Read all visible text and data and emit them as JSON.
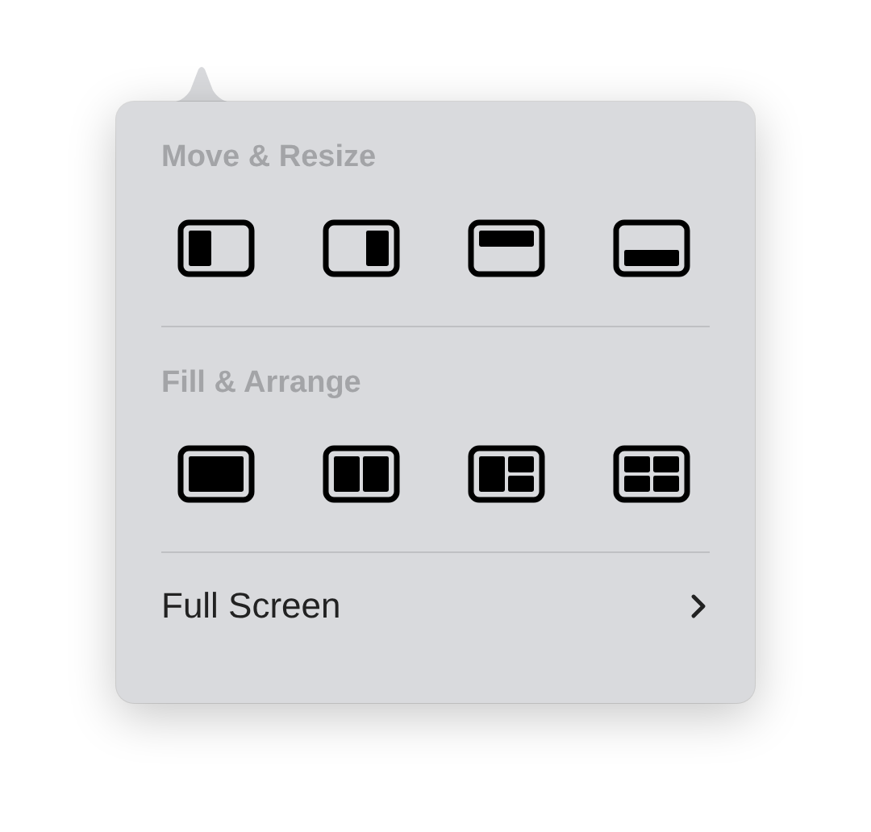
{
  "sections": [
    {
      "heading": "Move & Resize",
      "layouts": [
        {
          "kind": "left-half"
        },
        {
          "kind": "right-half"
        },
        {
          "kind": "top-half"
        },
        {
          "kind": "bottom-half"
        }
      ]
    },
    {
      "heading": "Fill & Arrange",
      "layouts": [
        {
          "kind": "fill"
        },
        {
          "kind": "halves"
        },
        {
          "kind": "left-and-stack"
        },
        {
          "kind": "quarters"
        }
      ]
    }
  ],
  "full_screen": {
    "label": "Full Screen",
    "expandable": true
  }
}
